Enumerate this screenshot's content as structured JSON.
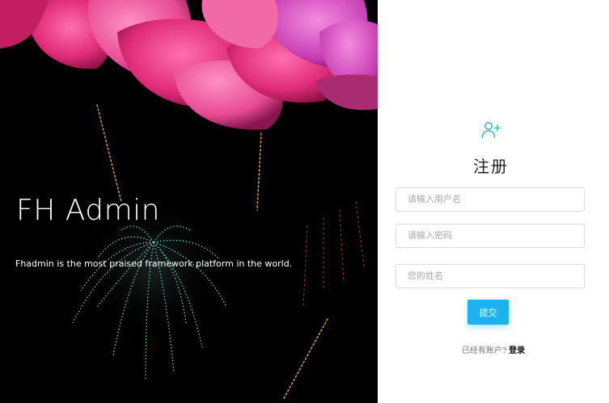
{
  "hero": {
    "title": "FH Admin",
    "subtitle": "Fhadmin is the most praised framework platform in the world."
  },
  "register_form": {
    "icon": "user-plus-icon",
    "title": "注册",
    "username": {
      "value": "",
      "placeholder": "请输入用户名"
    },
    "password": {
      "value": "",
      "placeholder": "请输入密码"
    },
    "fullname": {
      "value": "",
      "placeholder": "您的姓名"
    },
    "submit_label": "提交",
    "have_account_text": "已经有账户?",
    "login_link": "登录"
  },
  "colors": {
    "accent": "#1ab3f0",
    "icon": "#2cc6c0",
    "hero_background": "#000000"
  }
}
